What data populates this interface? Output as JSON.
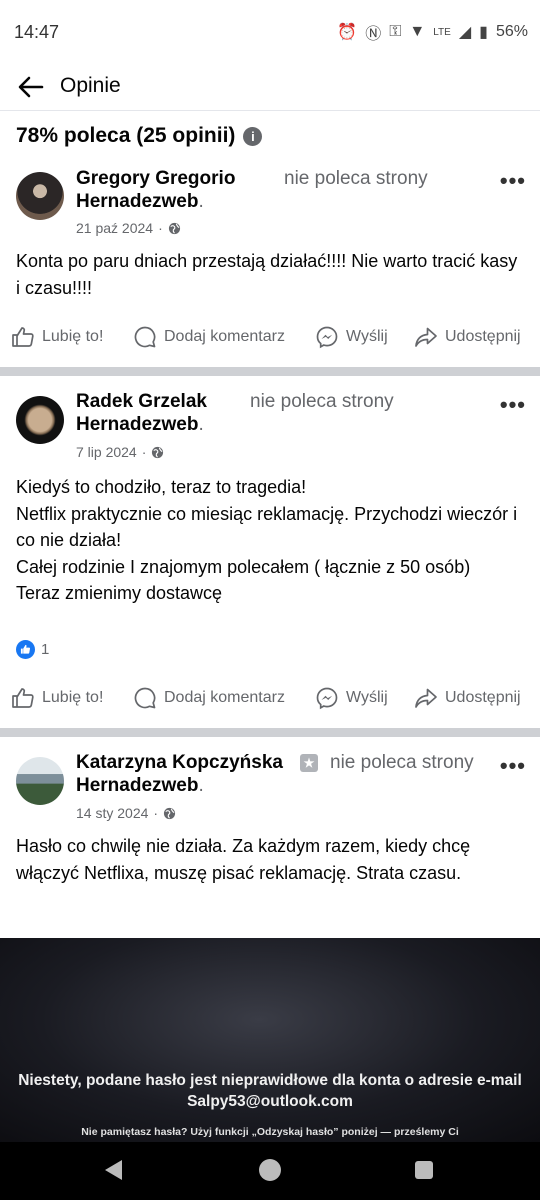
{
  "status": {
    "time": "14:47",
    "battery": "56%",
    "network": "LTE"
  },
  "header": {
    "title": "Opinie"
  },
  "summary": {
    "text": "78% poleca (25 opinii)"
  },
  "posts": [
    {
      "author": "Gregory Gregorio",
      "verdict": "nie poleca strony",
      "page": "Hernadezweb",
      "date": "21 paź 2024",
      "body": "Konta po paru dniach przestają działać!!!! Nie warto tracić kasy i czasu!!!!",
      "reactions": ""
    },
    {
      "author": "Radek Grzelak",
      "verdict": "nie poleca strony",
      "page": "Hernadezweb",
      "date": "7 lip 2024",
      "body": "Kiedyś to chodziło, teraz to tragedia!\nNetflix praktycznie co miesiąc reklamację. Przychodzi wieczór i co nie działa!\nCałej rodzinie I znajomym polecałem ( łącznie z 50 osób)\nTeraz zmienimy dostawcę",
      "reactions": "1"
    },
    {
      "author": "Katarzyna Kopczyńska",
      "verdict": "nie poleca strony",
      "page": "Hernadezweb",
      "date": "14 sty 2024",
      "body": "Hasło co chwilę nie działa. Za każdym razem, kiedy chcę włączyć Netflixa, muszę pisać reklamację. Strata czasu.",
      "reactions": ""
    }
  ],
  "actions": {
    "like": "Lubię to!",
    "comment": "Dodaj komentarz",
    "send": "Wyślij",
    "share": "Udostępnij"
  },
  "media": {
    "message": "Niestety, podane hasło jest nieprawidłowe dla konta o adresie e-mail Salpy53@outlook.com",
    "hint": "Nie pamiętasz hasła? Użyj funkcji „Odzyskaj hasło” poniżej — prześlemy Ci"
  },
  "colors": {
    "accent": "#1877f2",
    "muted": "#65676b",
    "divider": "#ced0d4"
  }
}
